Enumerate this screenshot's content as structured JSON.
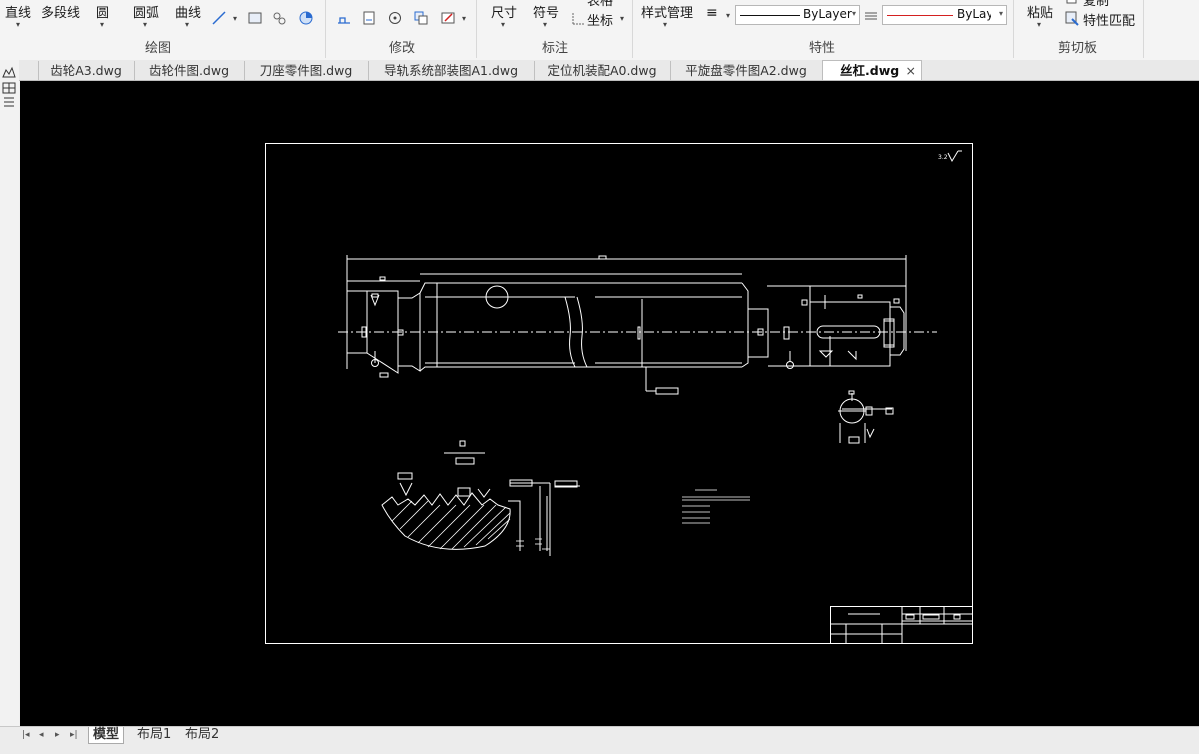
{
  "ribbon": {
    "draw": {
      "line": "直线",
      "polyline": "多段线",
      "circle": "圆",
      "arc": "圆弧",
      "curve": "曲线",
      "group": "绘图"
    },
    "modify": {
      "group": "修改"
    },
    "annotate": {
      "dimension": "尺寸",
      "symbol": "符号",
      "table": "表格",
      "coordinate": "坐标",
      "group": "标注"
    },
    "properties": {
      "style_manager": "样式管理",
      "linetype": "ByLayer",
      "color": "ByLayer",
      "group": "特性"
    },
    "clipboard": {
      "paste": "粘贴",
      "copy": "复制",
      "match": "特性匹配",
      "group": "剪切板"
    }
  },
  "tabs": [
    {
      "label": "齿轮A3.dwg",
      "active": false
    },
    {
      "label": "齿轮件图.dwg",
      "active": false
    },
    {
      "label": "刀座零件图.dwg",
      "active": false
    },
    {
      "label": "导轨系统部装图A1.dwg",
      "active": false
    },
    {
      "label": "定位机装配A0.dwg",
      "active": false
    },
    {
      "label": "平旋盘零件图A2.dwg",
      "active": false
    },
    {
      "label": "丝杠.dwg",
      "active": true,
      "close": "×"
    }
  ],
  "layout_tabs": [
    {
      "label": "模型",
      "active": true
    },
    {
      "label": "布局1",
      "active": false
    },
    {
      "label": "布局2",
      "active": false
    }
  ],
  "colors": {
    "accent_red": "#d42020",
    "canvas": "#000000",
    "drawing_line": "#ffffff"
  },
  "icons": {
    "left_palette": [
      "palette-tool-icon",
      "palette-grid-icon",
      "palette-property-icon"
    ],
    "nav": [
      "first-icon",
      "prev-icon",
      "next-icon",
      "last-icon"
    ]
  }
}
